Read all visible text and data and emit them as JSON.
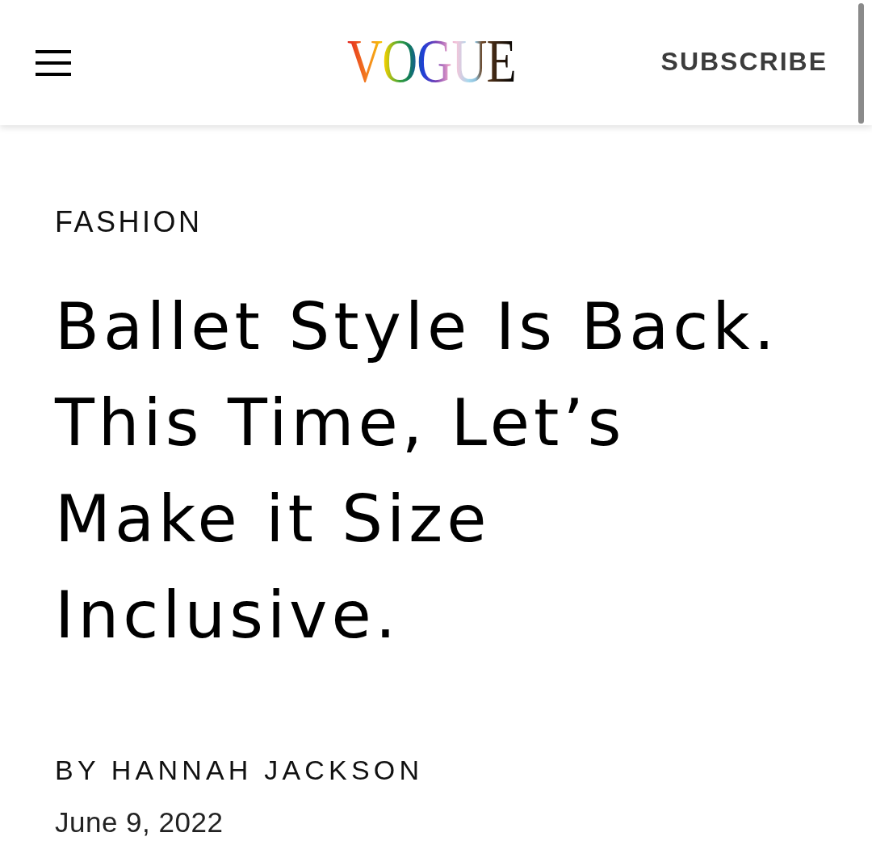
{
  "header": {
    "logo": "VOGUE",
    "subscribe": "SUBSCRIBE"
  },
  "article": {
    "section": "FASHION",
    "headline": "Ballet Style Is Back. This Time, Let’s Make it Size Inclusive.",
    "byline": "BY HANNAH JACKSON",
    "date": "June 9, 2022"
  }
}
